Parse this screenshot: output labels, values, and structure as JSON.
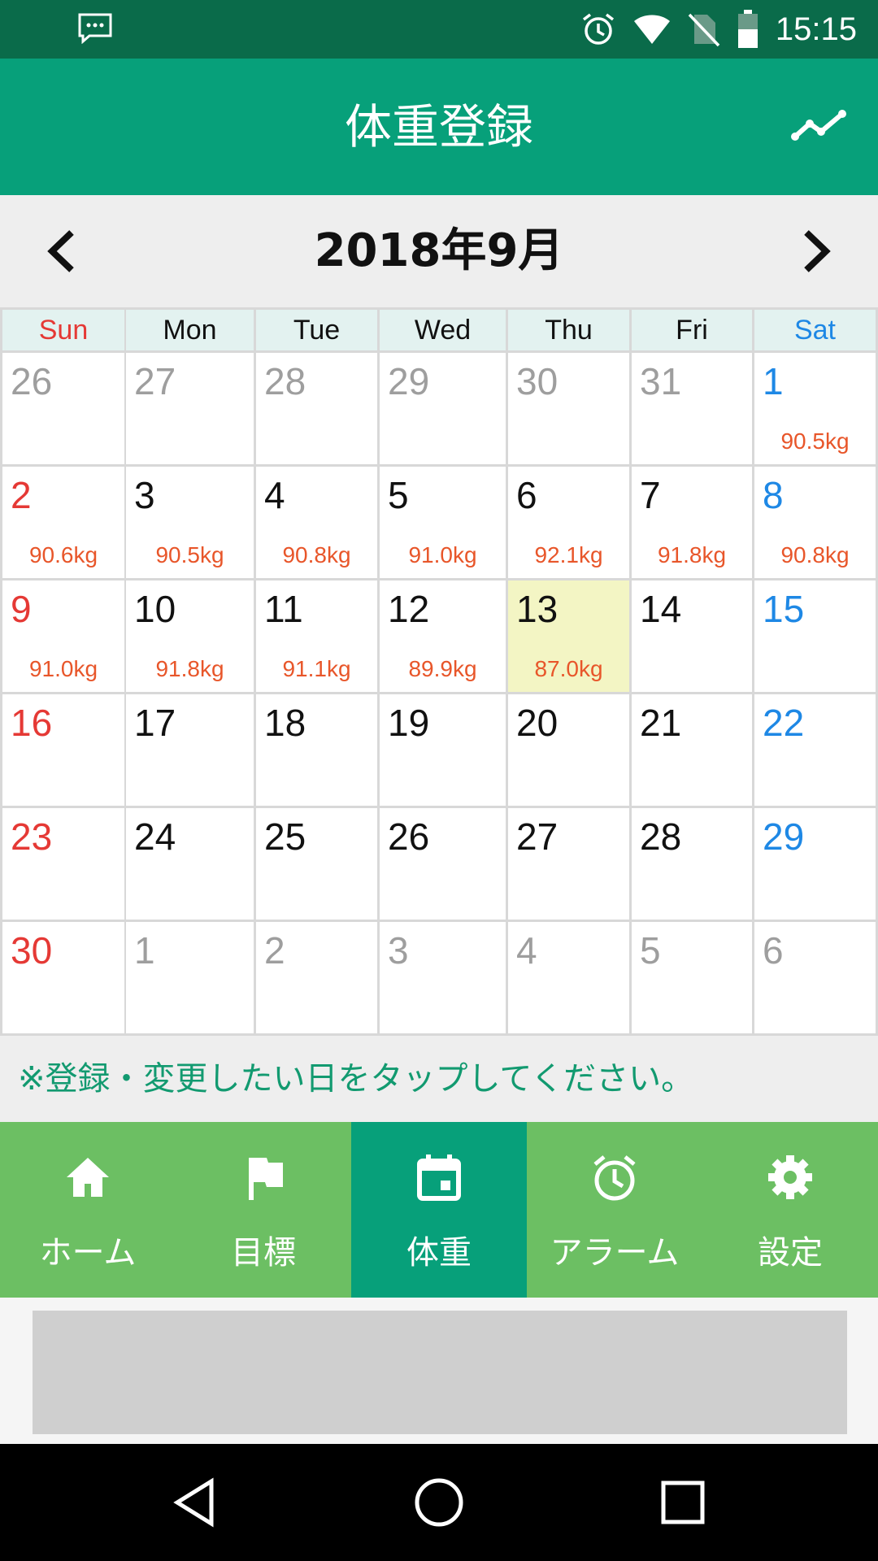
{
  "status_bar": {
    "time": "15:15",
    "icons": [
      "message-icon",
      "alarm-icon",
      "wifi-icon",
      "no-sim-icon",
      "battery-icon"
    ]
  },
  "app_bar": {
    "title": "体重登録",
    "action_icon": "trend-graph-icon"
  },
  "month_nav": {
    "label": "2018年9月",
    "prev_icon": "chevron-left-icon",
    "next_icon": "chevron-right-icon"
  },
  "weekdays": [
    "Sun",
    "Mon",
    "Tue",
    "Wed",
    "Thu",
    "Fri",
    "Sat"
  ],
  "weeks": [
    [
      {
        "day": "26",
        "other": true
      },
      {
        "day": "27",
        "other": true
      },
      {
        "day": "28",
        "other": true
      },
      {
        "day": "29",
        "other": true
      },
      {
        "day": "30",
        "other": true
      },
      {
        "day": "31",
        "other": true
      },
      {
        "day": "1",
        "weight": "90.5kg"
      }
    ],
    [
      {
        "day": "2",
        "weight": "90.6kg"
      },
      {
        "day": "3",
        "weight": "90.5kg"
      },
      {
        "day": "4",
        "weight": "90.8kg"
      },
      {
        "day": "5",
        "weight": "91.0kg"
      },
      {
        "day": "6",
        "weight": "92.1kg"
      },
      {
        "day": "7",
        "weight": "91.8kg"
      },
      {
        "day": "8",
        "weight": "90.8kg"
      }
    ],
    [
      {
        "day": "9",
        "weight": "91.0kg"
      },
      {
        "day": "10",
        "weight": "91.8kg"
      },
      {
        "day": "11",
        "weight": "91.1kg"
      },
      {
        "day": "12",
        "weight": "89.9kg"
      },
      {
        "day": "13",
        "weight": "87.0kg",
        "today": true
      },
      {
        "day": "14"
      },
      {
        "day": "15"
      }
    ],
    [
      {
        "day": "16"
      },
      {
        "day": "17"
      },
      {
        "day": "18"
      },
      {
        "day": "19"
      },
      {
        "day": "20"
      },
      {
        "day": "21"
      },
      {
        "day": "22"
      }
    ],
    [
      {
        "day": "23"
      },
      {
        "day": "24"
      },
      {
        "day": "25"
      },
      {
        "day": "26"
      },
      {
        "day": "27"
      },
      {
        "day": "28"
      },
      {
        "day": "29"
      }
    ],
    [
      {
        "day": "30"
      },
      {
        "day": "1",
        "other": true
      },
      {
        "day": "2",
        "other": true
      },
      {
        "day": "3",
        "other": true
      },
      {
        "day": "4",
        "other": true
      },
      {
        "day": "5",
        "other": true
      },
      {
        "day": "6",
        "other": true
      }
    ]
  ],
  "hint": "※登録・変更したい日をタップしてください。",
  "bottom_nav": [
    {
      "label": "ホーム",
      "icon": "home-icon"
    },
    {
      "label": "目標",
      "icon": "flag-icon"
    },
    {
      "label": "体重",
      "icon": "calendar-icon",
      "active": true
    },
    {
      "label": "アラーム",
      "icon": "alarm-clock-icon"
    },
    {
      "label": "設定",
      "icon": "gear-icon"
    }
  ],
  "colors": {
    "status_bar": "#0a6b4a",
    "app_bar": "#07a07a",
    "nav_bg": "#6cbf63",
    "weight_text": "#e8562a",
    "sunday": "#e53935",
    "saturday": "#1e88e5",
    "today_bg": "#f3f5c4"
  }
}
